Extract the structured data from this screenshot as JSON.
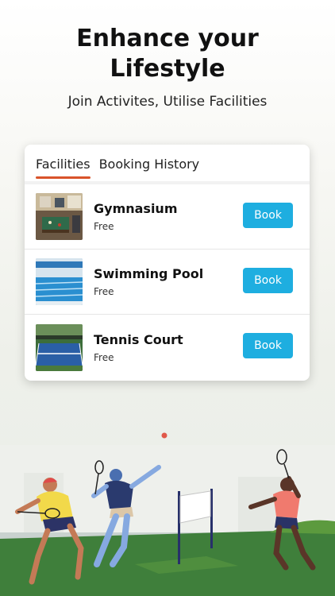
{
  "hero": {
    "title_line1": "Enhance your",
    "title_line2": "Lifestyle",
    "subtitle": "Join Activites, Utilise Facilities"
  },
  "tabs": [
    {
      "label": "Facilities",
      "active": true
    },
    {
      "label": "Booking History",
      "active": false
    }
  ],
  "facilities": [
    {
      "name": "Gymnasium",
      "price": "Free",
      "button": "Book",
      "icon": "gym-photo"
    },
    {
      "name": "Swimming Pool",
      "price": "Free",
      "button": "Book",
      "icon": "pool-photo"
    },
    {
      "name": "Tennis Court",
      "price": "Free",
      "button": "Book",
      "icon": "tennis-court-photo"
    }
  ],
  "colors": {
    "accent": "#d9532a",
    "button": "#1eaee0",
    "grass": "#3e7e3a"
  }
}
